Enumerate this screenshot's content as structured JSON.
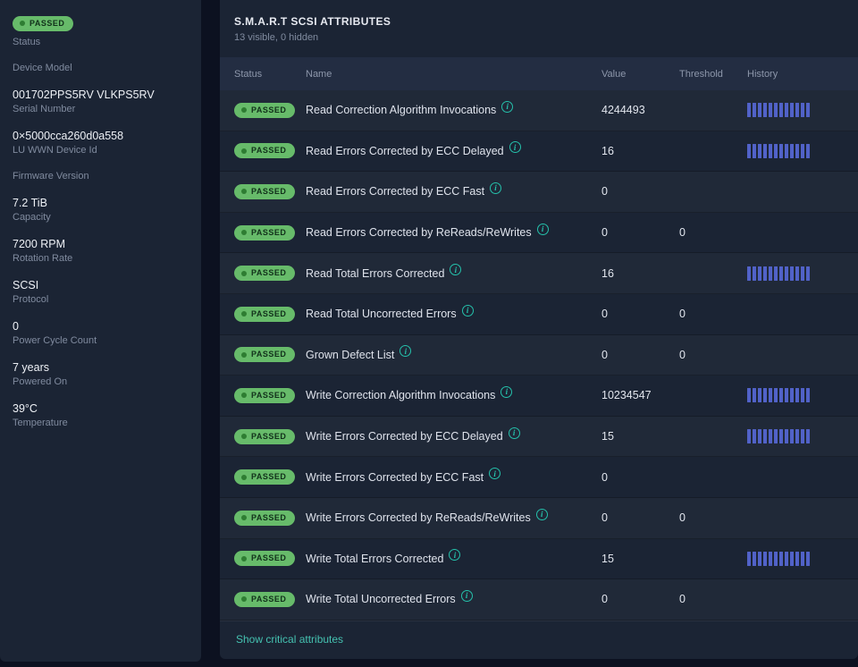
{
  "colors": {
    "badge_bg": "#67bb6a",
    "badge_text": "#11301a",
    "badge_dot": "#2e7d32",
    "history_bar": "#5162c8",
    "info": "#25c1ab",
    "link": "#45c2b1"
  },
  "sidebar": {
    "items": [
      {
        "badge": true,
        "value": "PASSED",
        "label": "Status"
      },
      {
        "value": "",
        "label": "Device Model"
      },
      {
        "value": "001702PPS5RV VLKPS5RV",
        "label": "Serial Number"
      },
      {
        "value": "0×5000cca260d0a558",
        "label": "LU WWN Device Id"
      },
      {
        "value": "",
        "label": "Firmware Version"
      },
      {
        "value": "7.2 TiB",
        "label": "Capacity"
      },
      {
        "value": "7200 RPM",
        "label": "Rotation Rate"
      },
      {
        "value": "SCSI",
        "label": "Protocol"
      },
      {
        "value": "0",
        "label": "Power Cycle Count"
      },
      {
        "value": "7 years",
        "label": "Powered On"
      },
      {
        "value": "39°C",
        "label": "Temperature"
      }
    ]
  },
  "main": {
    "title": "S.M.A.R.T SCSI ATTRIBUTES",
    "subtitle": "13 visible, 0 hidden",
    "columns": [
      "Status",
      "Name",
      "Value",
      "Threshold",
      "History"
    ],
    "history_points": 12,
    "rows": [
      {
        "status": "PASSED",
        "name": "Read Correction Algorithm Invocations",
        "value": "4244493",
        "threshold": "",
        "history": true
      },
      {
        "status": "PASSED",
        "name": "Read Errors Corrected by ECC Delayed",
        "value": "16",
        "threshold": "",
        "history": true
      },
      {
        "status": "PASSED",
        "name": "Read Errors Corrected by ECC Fast",
        "value": "0",
        "threshold": "",
        "history": false
      },
      {
        "status": "PASSED",
        "name": "Read Errors Corrected by ReReads/ReWrites",
        "value": "0",
        "threshold": "0",
        "history": false
      },
      {
        "status": "PASSED",
        "name": "Read Total Errors Corrected",
        "value": "16",
        "threshold": "",
        "history": true
      },
      {
        "status": "PASSED",
        "name": "Read Total Uncorrected Errors",
        "value": "0",
        "threshold": "0",
        "history": false
      },
      {
        "status": "PASSED",
        "name": "Grown Defect List",
        "value": "0",
        "threshold": "0",
        "history": false
      },
      {
        "status": "PASSED",
        "name": "Write Correction Algorithm Invocations",
        "value": "10234547",
        "threshold": "",
        "history": true
      },
      {
        "status": "PASSED",
        "name": "Write Errors Corrected by ECC Delayed",
        "value": "15",
        "threshold": "",
        "history": true
      },
      {
        "status": "PASSED",
        "name": "Write Errors Corrected by ECC Fast",
        "value": "0",
        "threshold": "",
        "history": false
      },
      {
        "status": "PASSED",
        "name": "Write Errors Corrected by ReReads/ReWrites",
        "value": "0",
        "threshold": "0",
        "history": false
      },
      {
        "status": "PASSED",
        "name": "Write Total Errors Corrected",
        "value": "15",
        "threshold": "",
        "history": true
      },
      {
        "status": "PASSED",
        "name": "Write Total Uncorrected Errors",
        "value": "0",
        "threshold": "0",
        "history": false
      }
    ],
    "footer_link": "Show critical attributes"
  }
}
